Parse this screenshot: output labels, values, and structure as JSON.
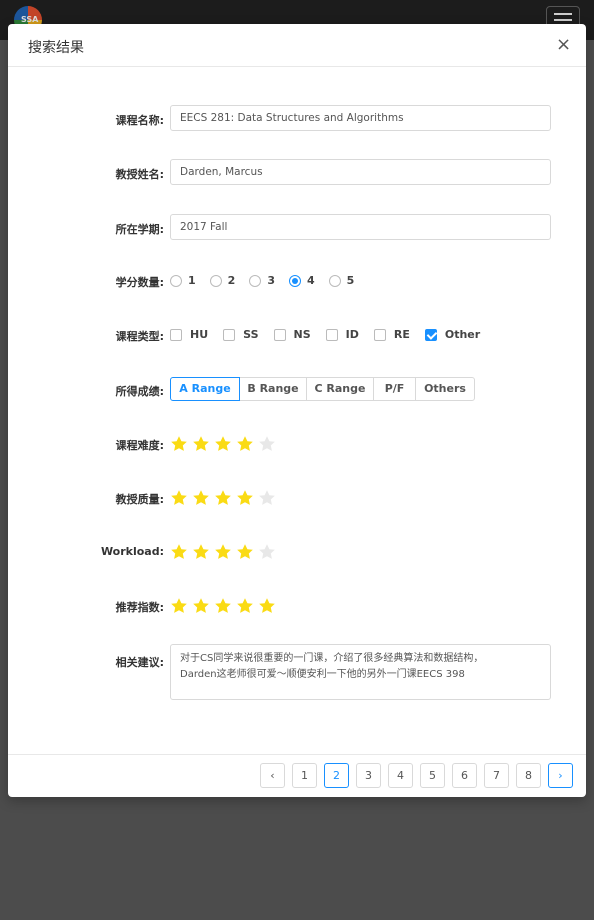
{
  "topbar": {
    "logo_text": "SSA"
  },
  "modal": {
    "title": "搜索结果",
    "close_symbol": "×"
  },
  "form": {
    "course_name": {
      "label": "课程名称:",
      "value": "EECS 281: Data Structures and Algorithms"
    },
    "professor": {
      "label": "教授姓名:",
      "value": "Darden, Marcus"
    },
    "term": {
      "label": "所在学期:",
      "value": "2017 Fall"
    },
    "credits": {
      "label": "学分数量:",
      "options": [
        "1",
        "2",
        "3",
        "4",
        "5"
      ],
      "selected": "4"
    },
    "course_type": {
      "label": "课程类型:",
      "options": [
        "HU",
        "SS",
        "NS",
        "ID",
        "RE",
        "Other"
      ],
      "checked": [
        "Other"
      ]
    },
    "grade": {
      "label": "所得成绩:",
      "options": [
        "A Range",
        "B Range",
        "C Range",
        "P/F",
        "Others"
      ],
      "selected": "A Range"
    },
    "difficulty": {
      "label": "课程难度:",
      "rating": 4,
      "max": 5
    },
    "prof_quality": {
      "label": "教授质量:",
      "rating": 4,
      "max": 5
    },
    "workload": {
      "label": "Workload:",
      "rating": 4,
      "max": 5
    },
    "recommend": {
      "label": "推荐指数:",
      "rating": 5,
      "max": 5
    },
    "comments": {
      "label": "相关建议:",
      "line1": "对于CS同学来说很重要的一门课，介绍了很多经典算法和数据结构，",
      "line2": "Darden这老师很可爱～顺便安利一下他的另外一门课EECS 398"
    }
  },
  "pagination": {
    "prev_symbol": "‹",
    "next_symbol": "›",
    "pages": [
      "1",
      "2",
      "3",
      "4",
      "5",
      "6",
      "7",
      "8"
    ],
    "current": "2"
  },
  "colors": {
    "accent": "#1890ff",
    "star_on": "#fadb14",
    "star_off": "#e8e8e8"
  }
}
